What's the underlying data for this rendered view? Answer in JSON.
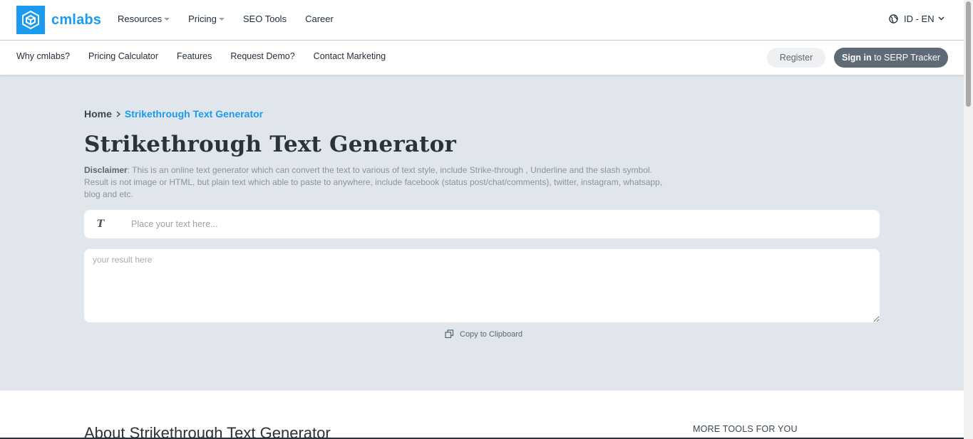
{
  "brand": {
    "name": "cmlabs",
    "color": "#1a9bf0"
  },
  "main_nav": [
    {
      "label": "Resources",
      "has_dropdown": true
    },
    {
      "label": "Pricing",
      "has_dropdown": true
    },
    {
      "label": "SEO Tools",
      "has_dropdown": false
    },
    {
      "label": "Career",
      "has_dropdown": false
    }
  ],
  "language": {
    "label": "ID - EN",
    "icon": "globe-icon"
  },
  "sub_nav": [
    "Why cmlabs?",
    "Pricing Calculator",
    "Features",
    "Request Demo?",
    "Contact Marketing"
  ],
  "auth": {
    "register_label": "Register",
    "signin_bold": "Sign in",
    "signin_rest": " to SERP Tracker"
  },
  "breadcrumb": {
    "home": "Home",
    "current": "Strikethrough Text Generator"
  },
  "page": {
    "title": "Strikethrough Text Generator",
    "disclaimer_label": "Disclaimer",
    "disclaimer_text": ": This is an online text generator which can convert the text to various of text style, include Strike-through , Underline and the slash symbol. Result is not image or HTML, but plain text which able to paste to anywhere, include facebook (status post/chat/comments), twitter, instagram, whatsapp, blog and etc."
  },
  "generator": {
    "input_icon": "T",
    "input_placeholder": "Place your text here...",
    "input_value": "",
    "result_placeholder": "your result here",
    "copy_label": "Copy to Clipboard"
  },
  "about": {
    "title": "About Strikethrough Text Generator"
  },
  "sidebar": {
    "more_tools": "MORE TOOLS FOR YOU"
  }
}
